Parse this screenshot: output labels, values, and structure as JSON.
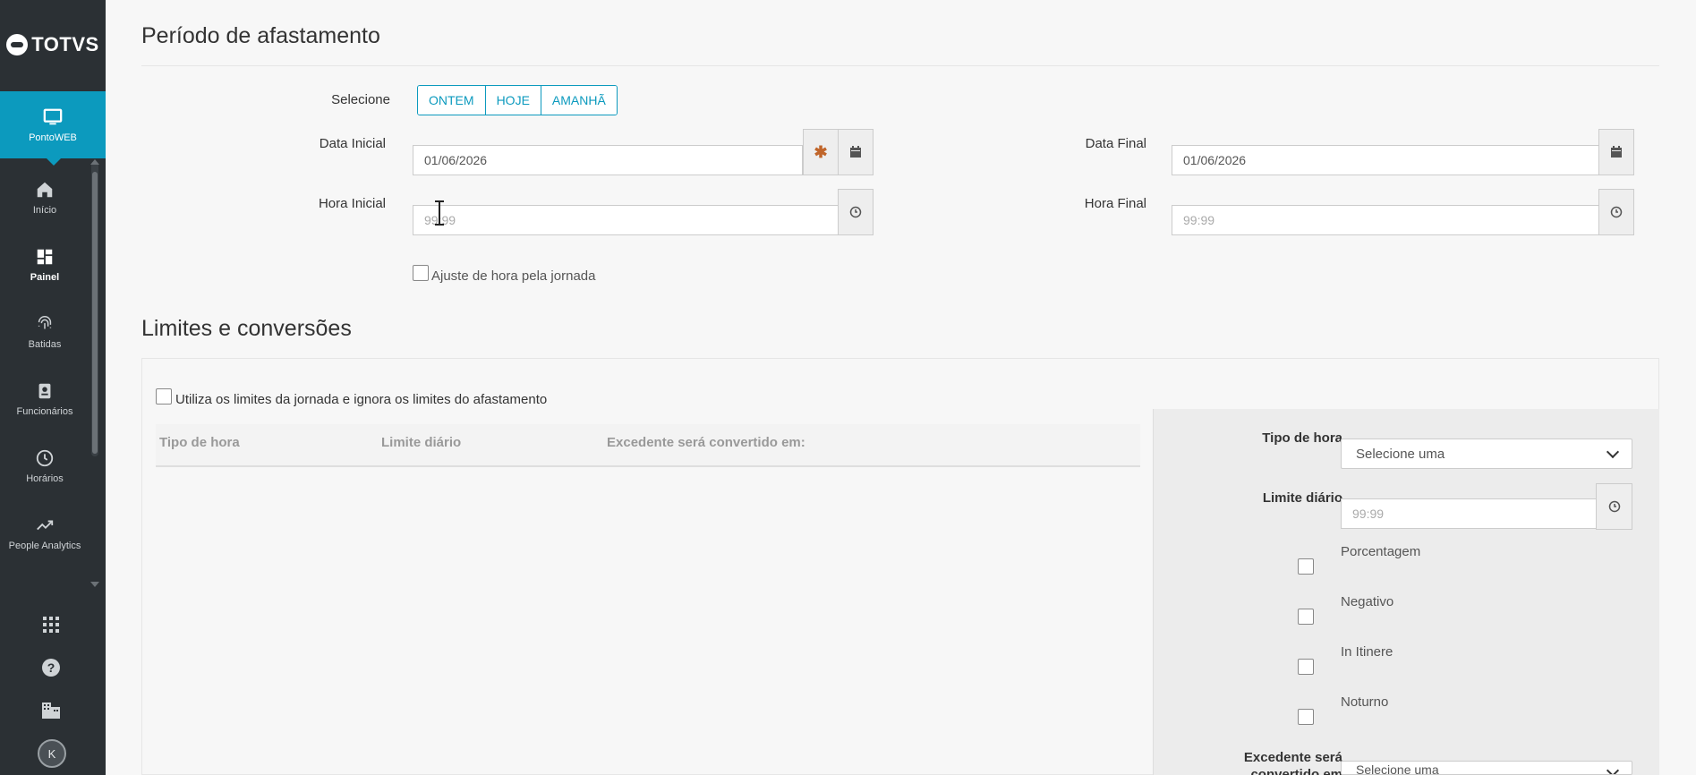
{
  "sidebar": {
    "logo_text": "TOTVS",
    "active": {
      "label": "PontoWEB",
      "icon": "monitor-icon"
    },
    "items": [
      {
        "label": "Início",
        "icon": "home-icon"
      },
      {
        "label": "Painel",
        "icon": "dashboard-icon"
      },
      {
        "label": "Batidas",
        "icon": "fingerprint-icon"
      },
      {
        "label": "Funcionários",
        "icon": "badge-icon"
      },
      {
        "label": "Horários",
        "icon": "clock-icon"
      },
      {
        "label": "People Analytics",
        "icon": "trend-icon"
      }
    ],
    "bottom_icons": [
      "apps-icon",
      "help-icon",
      "building-icon"
    ],
    "avatar_initial": "K"
  },
  "periodo": {
    "title": "Período de afastamento",
    "selecione_label": "Selecione",
    "quick_buttons": [
      "ONTEM",
      "HOJE",
      "AMANHÃ"
    ],
    "data_inicial_label": "Data Inicial",
    "data_inicial_value": "01/06/2026",
    "data_final_label": "Data Final",
    "data_final_value": "01/06/2026",
    "hora_inicial_label": "Hora Inicial",
    "hora_inicial_placeholder": "99:99",
    "hora_final_label": "Hora Final",
    "hora_final_placeholder": "99:99",
    "ajuste_label": "Ajuste de hora pela jornada"
  },
  "limites": {
    "title": "Limites e conversões",
    "utiliza_label": "Utiliza os limites da jornada e ignora os limites do afastamento",
    "table_headers": [
      "Tipo de hora",
      "Limite diário",
      "Excedente será convertido em:"
    ],
    "form": {
      "tipo_label": "Tipo de hora",
      "tipo_value": "Selecione uma",
      "limite_label": "Limite diário",
      "limite_placeholder": "99:99",
      "checks": [
        "Porcentagem",
        "Negativo",
        "In Itinere",
        "Noturno"
      ],
      "excedente_label_line1": "Excedente será",
      "excedente_label_line2": "convertido em",
      "excedente_value": "Selecione uma"
    }
  },
  "colors": {
    "accent": "#0c9abe",
    "sidebar": "#2b3034",
    "required": "#c0652a"
  }
}
